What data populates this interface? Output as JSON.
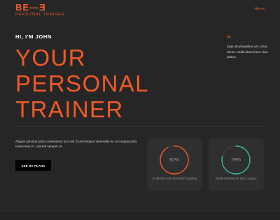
{
  "brand": {
    "logo_mark": "BE—Ǝ",
    "logo_sub": "PERSONAL TRAINER",
    "accent": "#f05a28"
  },
  "nav": {
    "home": "Home"
  },
  "hero": {
    "greeting": "HI, I'M JOHN",
    "line1": "YOUR",
    "line2": "PERSONAL",
    "line3": "TRAINER"
  },
  "quote": {
    "icon": "quote-icon",
    "text": "Eget elit phasellus vel, tortor, donec. Nulla diam fusce duis platea."
  },
  "intro": {
    "text": "Aliquet pulvinar justo consectetur orci nisl. Duis tristique venenatis eu ut congue justo, maecenas in. Laoreet semper ut.",
    "cta": "SEE MY PLANS"
  },
  "stats": [
    {
      "value": "92%",
      "percent": 92,
      "color": "#f05a28",
      "caption": "In ultrices odio tincidunt faucibus"
    },
    {
      "value": "79%",
      "percent": 79,
      "color": "#3fb7a9",
      "caption": "Morbi fermentum sed, congue"
    }
  ]
}
